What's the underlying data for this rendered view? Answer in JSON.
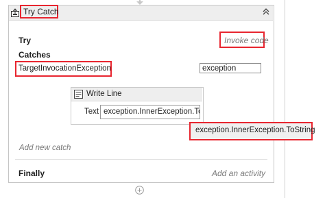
{
  "activity": {
    "title": "Try Catch",
    "try_label": "Try",
    "try_action": "Invoke code",
    "catches_label": "Catches",
    "catch_exception_type": "TargetInvocationException",
    "catch_variable": "exception",
    "add_new_catch": "Add new catch",
    "finally_label": "Finally",
    "finally_action": "Add an activity"
  },
  "write_line": {
    "title": "Write Line",
    "text_label": "Text",
    "text_value": "exception.InnerException.ToS"
  },
  "tooltip": {
    "text": "exception.InnerException.ToString"
  },
  "colors": {
    "highlight": "#e8252f",
    "header_bg": "#eeeeee"
  },
  "icons": {
    "try_catch": "try-catch-icon",
    "collapse": "double-chevron-up-icon",
    "write_line": "write-line-icon",
    "add": "add-circle-icon"
  }
}
